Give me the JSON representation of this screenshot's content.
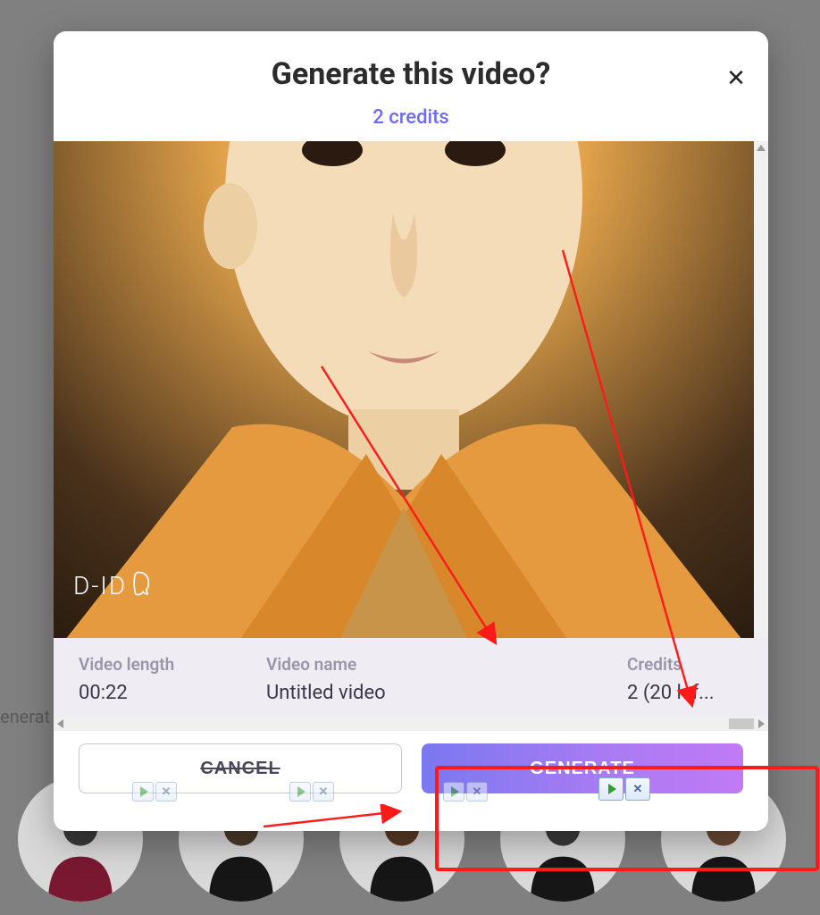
{
  "background": {
    "label": "enerat"
  },
  "modal": {
    "title": "Generate this video?",
    "credits_line": "2 credits",
    "close_label": "✕",
    "watermark": "D-ID",
    "fields": {
      "length_label": "Video length",
      "length_value": "00:22",
      "name_label": "Video name",
      "name_value": "Untitled video",
      "credits_label": "Credits",
      "credits_value": "2 (20 lef..."
    },
    "buttons": {
      "cancel": "CANCEL",
      "generate": "GENERATE"
    }
  }
}
